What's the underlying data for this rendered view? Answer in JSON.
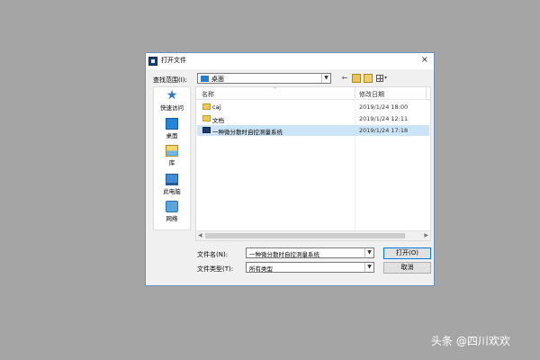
{
  "dialog": {
    "title": "打开文件",
    "close_glyph": "×",
    "lookin": {
      "label": "查找范围(I):",
      "value": "桌面"
    },
    "toolbar": {
      "back": "←",
      "view_arrow": "▾"
    },
    "places": [
      {
        "label": "快速访问",
        "icon": "star-icon"
      },
      {
        "label": "桌面",
        "icon": "desktop-icon"
      },
      {
        "label": "库",
        "icon": "library-icon"
      },
      {
        "label": "此电脑",
        "icon": "computer-icon"
      },
      {
        "label": "网络",
        "icon": "network-icon"
      }
    ],
    "columns": {
      "name": "名称",
      "date": "修改日期",
      "sort_glyph": "^"
    },
    "files": [
      {
        "name": "caj",
        "date": "2019/1/24 18:00",
        "type": "folder",
        "selected": false
      },
      {
        "name": "文档",
        "date": "2019/1/24 12:11",
        "type": "folder",
        "selected": false
      },
      {
        "name": "一种微分散时自控测量系统",
        "date": "2019/1/24 17:18",
        "type": "app",
        "selected": true
      }
    ],
    "filename": {
      "label": "文件名(N):",
      "value": "一种微分散时自控测量系统"
    },
    "filetype": {
      "label": "文件类型(T):",
      "value": "所有类型"
    },
    "buttons": {
      "open": "打开(O)",
      "cancel": "取消"
    }
  },
  "watermark": "头条 @四川欢欢"
}
